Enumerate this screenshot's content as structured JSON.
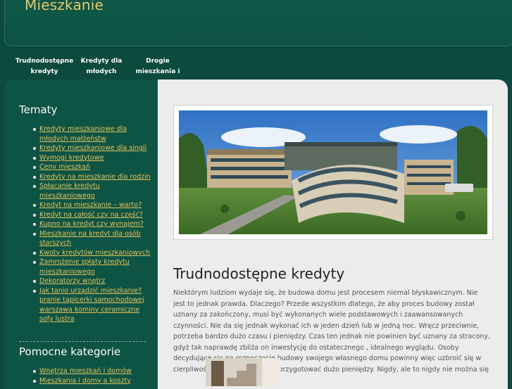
{
  "site": {
    "title": "Mieszkanie"
  },
  "nav": {
    "items": [
      {
        "line1": "Trudnodostępne",
        "line2": "kredyty"
      },
      {
        "line1": "Kredyty dla",
        "line2": "młodych"
      },
      {
        "line1": "Drogie",
        "line2": "mieszkania i"
      }
    ]
  },
  "sidebar": {
    "tematy_heading": "Tematy",
    "tematy": [
      "Kredyty mieszkaniowe dla",
      "młodych małżeństw",
      "Kredyty mieszkaniowe dla singli",
      "Wymogi kredytowe",
      "Ceny mieszkań",
      "Kredyty na mieszkanie dla rodzin",
      "Spłacanie kredytu",
      "mieszkaniowego",
      "Kredyt na mieszkanie – warto?",
      "Kredyt na całość czy na część?",
      "Kupno na kredyt czy wynajem?",
      "Mieszkanie na kredyt dla osób",
      "starszych",
      "Kwoty kredytów mieszkaniowych",
      "Zamrożenie spłaty kredytu",
      "mieszkaniowego",
      "Dekoratorzy wnętrz",
      "Jak tanio urządzić mieszkanie?",
      "pranie tapicerki samochodowej",
      "warszawa",
      "kominy ceramiczne",
      "sofy",
      "lustra"
    ],
    "pomocne_heading": "Pomocne kategorie",
    "pomocne": [
      "Wnętrza mieszkań i domów",
      "Mieszkania i domy a koszty"
    ]
  },
  "post": {
    "title": "Trudnodostępne kredyty",
    "body": "Niektórym ludziom wydaje się, że budowa domu jest procesem niemal błyskawicznym. Nie jest to jednak prawda. Dlaczego? Przede wszystkim dlatego, że aby proces budowy został uznany za zakończony, musi być wykonanych wiele podstawowych i zaawansowanych czynności. Nie da się jednak wykonać ich w jeden dzień lub w jedną noc. Wręcz przeciwnie, potrzeba bardzo dużo czasu i pieniędzy. Czas ten jednak nie powinien być uznany za stracony, gdyż tak naprawdę zbliża on inwestycję do ostatecznego , idealnego wyglądu. Osoby decydujące się na rozpoczęcie budowy swojego własnego domu powinny więc uzbroić się w cierpliwość i przede wszystkim przygotować dużo pieniędzy. Nigdy, ale to nigdy nie można się"
  },
  "colors": {
    "background": "#0b4a3c",
    "title": "#e8c96a",
    "link": "#e2c25a",
    "content_bg": "#ececec"
  }
}
